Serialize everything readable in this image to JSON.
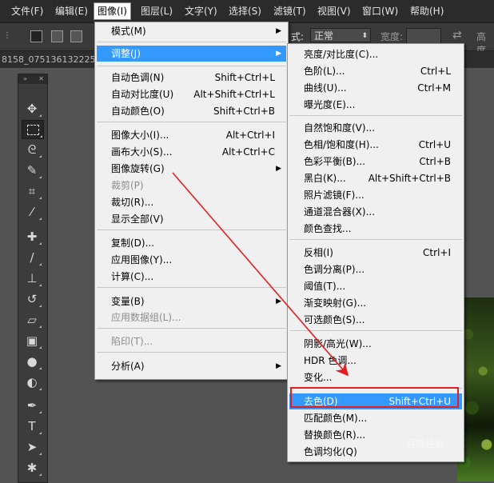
{
  "menubar": {
    "items": [
      "文件(F)",
      "编辑(E)",
      "图像(I)",
      "图层(L)",
      "文字(Y)",
      "选择(S)",
      "滤镜(T)",
      "视图(V)",
      "窗口(W)",
      "帮助(H)"
    ]
  },
  "options": {
    "style_label": "式:",
    "style_value": "正常",
    "width_label": "宽度:",
    "height_label": "高度"
  },
  "document": {
    "tab_title": "8158_075136132225"
  },
  "image_menu": {
    "items": [
      {
        "label": "模式(M)",
        "shortcut": "",
        "submenu": true
      },
      {
        "label": "调整(J)",
        "shortcut": "",
        "submenu": true
      },
      {
        "label": "自动色调(N)",
        "shortcut": "Shift+Ctrl+L"
      },
      {
        "label": "自动对比度(U)",
        "shortcut": "Alt+Shift+Ctrl+L"
      },
      {
        "label": "自动颜色(O)",
        "shortcut": "Shift+Ctrl+B"
      },
      {
        "label": "图像大小(I)...",
        "shortcut": "Alt+Ctrl+I"
      },
      {
        "label": "画布大小(S)...",
        "shortcut": "Alt+Ctrl+C"
      },
      {
        "label": "图像旋转(G)",
        "shortcut": "",
        "submenu": true
      },
      {
        "label": "裁剪(P)",
        "shortcut": "",
        "disabled": true
      },
      {
        "label": "裁切(R)...",
        "shortcut": ""
      },
      {
        "label": "显示全部(V)",
        "shortcut": ""
      },
      {
        "label": "复制(D)...",
        "shortcut": ""
      },
      {
        "label": "应用图像(Y)...",
        "shortcut": ""
      },
      {
        "label": "计算(C)...",
        "shortcut": ""
      },
      {
        "label": "变量(B)",
        "shortcut": "",
        "submenu": true
      },
      {
        "label": "应用数据组(L)...",
        "shortcut": "",
        "disabled": true
      },
      {
        "label": "陷印(T)...",
        "shortcut": "",
        "disabled": true
      },
      {
        "label": "分析(A)",
        "shortcut": "",
        "submenu": true
      }
    ]
  },
  "adjust_menu": {
    "items": [
      {
        "label": "亮度/对比度(C)...",
        "shortcut": ""
      },
      {
        "label": "色阶(L)...",
        "shortcut": "Ctrl+L"
      },
      {
        "label": "曲线(U)...",
        "shortcut": "Ctrl+M"
      },
      {
        "label": "曝光度(E)...",
        "shortcut": ""
      },
      {
        "label": "自然饱和度(V)...",
        "shortcut": ""
      },
      {
        "label": "色相/饱和度(H)...",
        "shortcut": "Ctrl+U"
      },
      {
        "label": "色彩平衡(B)...",
        "shortcut": "Ctrl+B"
      },
      {
        "label": "黑白(K)...",
        "shortcut": "Alt+Shift+Ctrl+B"
      },
      {
        "label": "照片滤镜(F)...",
        "shortcut": ""
      },
      {
        "label": "通道混合器(X)...",
        "shortcut": ""
      },
      {
        "label": "颜色查找...",
        "shortcut": ""
      },
      {
        "label": "反相(I)",
        "shortcut": "Ctrl+I"
      },
      {
        "label": "色调分离(P)...",
        "shortcut": ""
      },
      {
        "label": "阈值(T)...",
        "shortcut": ""
      },
      {
        "label": "渐变映射(G)...",
        "shortcut": ""
      },
      {
        "label": "可选颜色(S)...",
        "shortcut": ""
      },
      {
        "label": "阴影/高光(W)...",
        "shortcut": ""
      },
      {
        "label": "HDR 色调...",
        "shortcut": ""
      },
      {
        "label": "变化...",
        "shortcut": ""
      },
      {
        "label": "去色(D)",
        "shortcut": "Shift+Ctrl+U"
      },
      {
        "label": "匹配颜色(M)...",
        "shortcut": ""
      },
      {
        "label": "替换颜色(R)...",
        "shortcut": ""
      },
      {
        "label": "色调均化(Q)",
        "shortcut": ""
      }
    ]
  },
  "tools": [
    "move-icon",
    "marquee-icon",
    "lasso-icon",
    "quick-select-icon",
    "crop-icon",
    "eyedropper-icon",
    "healing-icon",
    "brush-icon",
    "stamp-icon",
    "history-brush-icon",
    "eraser-icon",
    "gradient-icon",
    "blur-icon",
    "dodge-icon",
    "pen-icon",
    "type-icon",
    "path-select-icon",
    "shape-icon"
  ],
  "watermark": "百度经验",
  "colors": {
    "highlight": "#3399ff",
    "annotation": "#e02020",
    "menu_bg": "#f0f0f0"
  }
}
